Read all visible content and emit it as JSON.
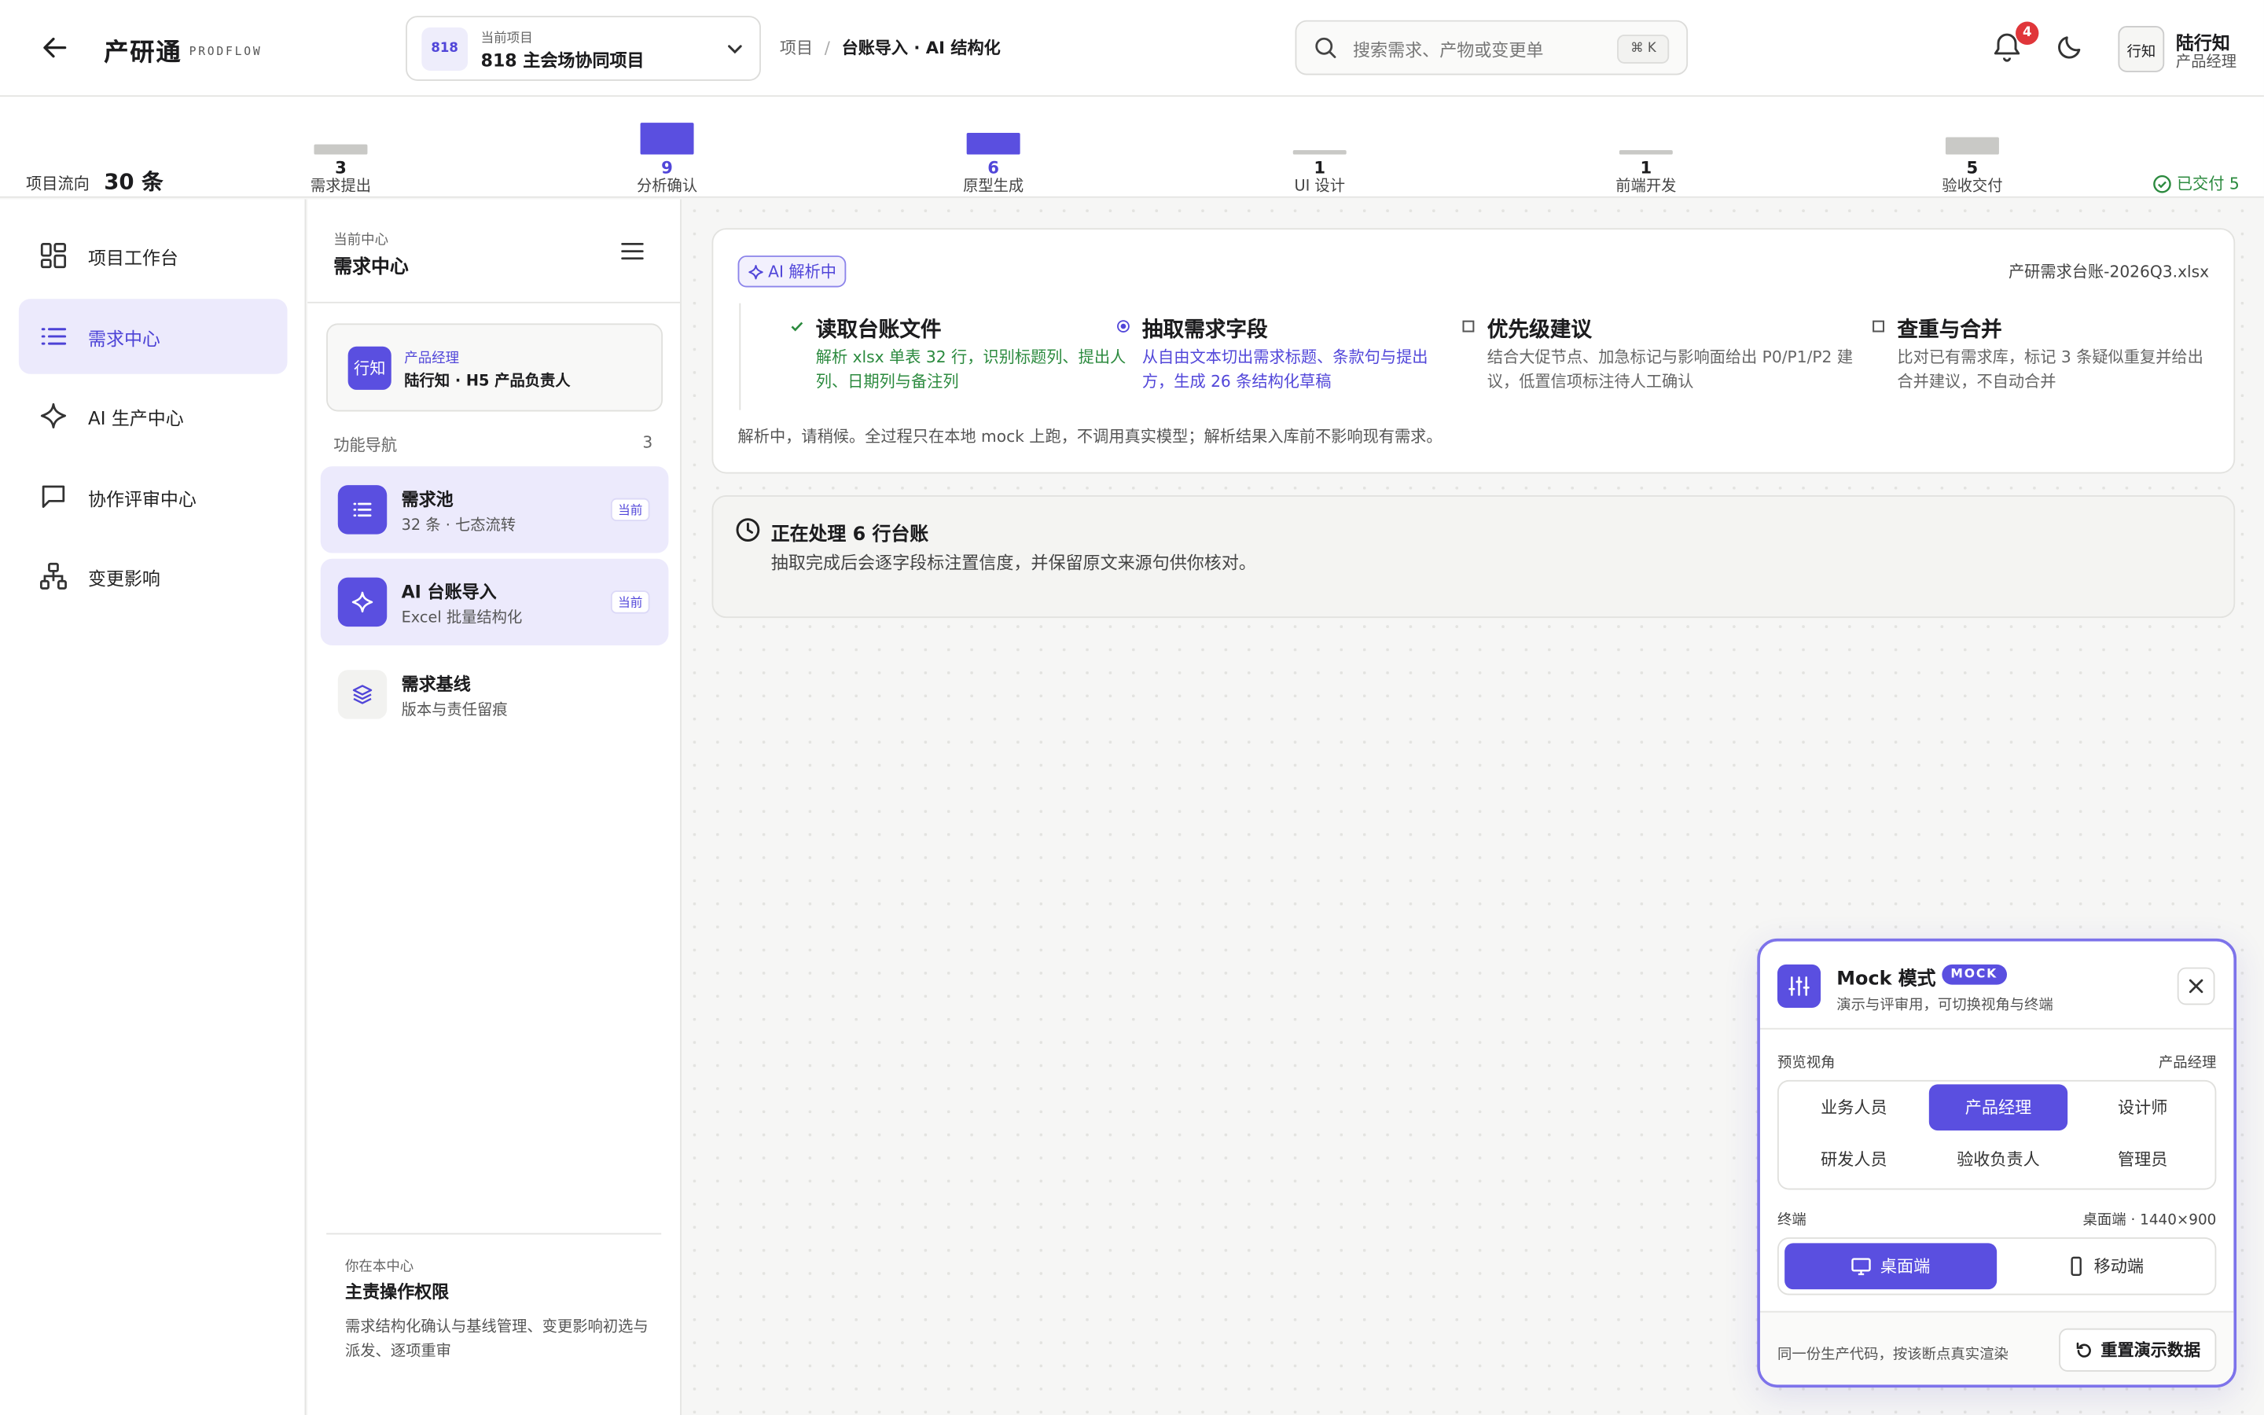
{
  "header": {
    "brand": "产研通",
    "brand_sub": "PRODFLOW",
    "project_badge": "818",
    "project_label": "当前项目",
    "project_name": "818 主会场协同项目",
    "breadcrumb_root": "项目",
    "breadcrumb_sep": "/",
    "breadcrumb_current": "台账导入 · AI 结构化",
    "search_placeholder": "搜索需求、产物或变更单",
    "search_shortcut": "⌘ K",
    "notification_count": "4",
    "avatar_text": "行知",
    "user_name": "陆行知",
    "user_role": "产品经理"
  },
  "flow": {
    "label": "项目流向",
    "count": "30 条",
    "stages": [
      {
        "label": "需求提出",
        "count": "3",
        "value": 3,
        "active": false
      },
      {
        "label": "分析确认",
        "count": "9",
        "value": 9,
        "active": true
      },
      {
        "label": "原型生成",
        "count": "6",
        "value": 6,
        "active": true
      },
      {
        "label": "UI 设计",
        "count": "1",
        "value": 1,
        "active": false
      },
      {
        "label": "前端开发",
        "count": "1",
        "value": 1,
        "active": false
      },
      {
        "label": "验收交付",
        "count": "5",
        "value": 5,
        "active": false
      }
    ],
    "delivered": "已交付 5"
  },
  "sidebar": {
    "items": [
      {
        "label": "项目工作台",
        "icon": "grid-icon"
      },
      {
        "label": "需求中心",
        "icon": "list-icon"
      },
      {
        "label": "AI 生产中心",
        "icon": "sparkle-icon"
      },
      {
        "label": "协作评审中心",
        "icon": "chat-icon"
      },
      {
        "label": "变更影响",
        "icon": "network-icon"
      }
    ]
  },
  "center": {
    "kicker": "当前中心",
    "title": "需求中心",
    "role_avatar": "行知",
    "role_kicker": "产品经理",
    "role_name": "陆行知 · H5 产品负责人",
    "nav_head": "功能导航",
    "nav_count": "3",
    "nav": [
      {
        "title": "需求池",
        "sub": "32 条 · 七态流转",
        "tag": "当前"
      },
      {
        "title": "AI 台账导入",
        "sub": "Excel 批量结构化",
        "tag": "当前"
      },
      {
        "title": "需求基线",
        "sub": "版本与责任留痕"
      }
    ],
    "foot_kicker": "你在本中心",
    "foot_title": "主责操作权限",
    "foot_desc": "需求结构化确认与基线管理、变更影响初选与派发、逐项重审"
  },
  "parse": {
    "chip": "AI 解析中",
    "filename": "产研需求台账-2026Q3.xlsx",
    "steps": [
      {
        "title": "读取台账文件",
        "desc": "解析 xlsx 单表 32 行，识别标题列、提出人列、日期列与备注列",
        "state": "done",
        "color": "#2b8a3e"
      },
      {
        "title": "抽取需求字段",
        "desc": "从自由文本切出需求标题、条款句与提出方，生成 26 条结构化草稿",
        "state": "running",
        "color": "#5146d9"
      },
      {
        "title": "优先级建议",
        "desc": "结合大促节点、加急标记与影响面给出 P0/P1/P2 建议，低置信项标注待人工确认",
        "state": "pending",
        "color": "#666666"
      },
      {
        "title": "查重与合并",
        "desc": "比对已有需求库，标记 3 条疑似重复并给出合并建议，不自动合并",
        "state": "pending",
        "color": "#666666"
      }
    ],
    "note": "解析中，请稍候。全过程只在本地 mock 上跑，不调用真实模型；解析结果入库前不影响现有需求。"
  },
  "processing": {
    "title": "正在处理 6 行台账",
    "desc": "抽取完成后会逐字段标注置信度，并保留原文来源句供你核对。"
  },
  "mock": {
    "title": "Mock 模式",
    "badge": "MOCK",
    "subtitle": "演示与评审用，可切换视角与终端",
    "view_label": "预览视角",
    "view_value": "产品经理",
    "roles": [
      "业务人员",
      "产品经理",
      "设计师",
      "研发人员",
      "验收负责人",
      "管理员"
    ],
    "active_role": 1,
    "terminal_label": "终端",
    "terminal_value": "桌面端 · 1440×900",
    "terminals": [
      "桌面端",
      "移动端"
    ],
    "foot_text": "同一份生产代码，按该断点真实渲染",
    "reset_label": "重置演示数据"
  },
  "colors": {
    "accent": "#5a4fe0",
    "success": "#2b8a3e",
    "danger": "#e0363a"
  }
}
